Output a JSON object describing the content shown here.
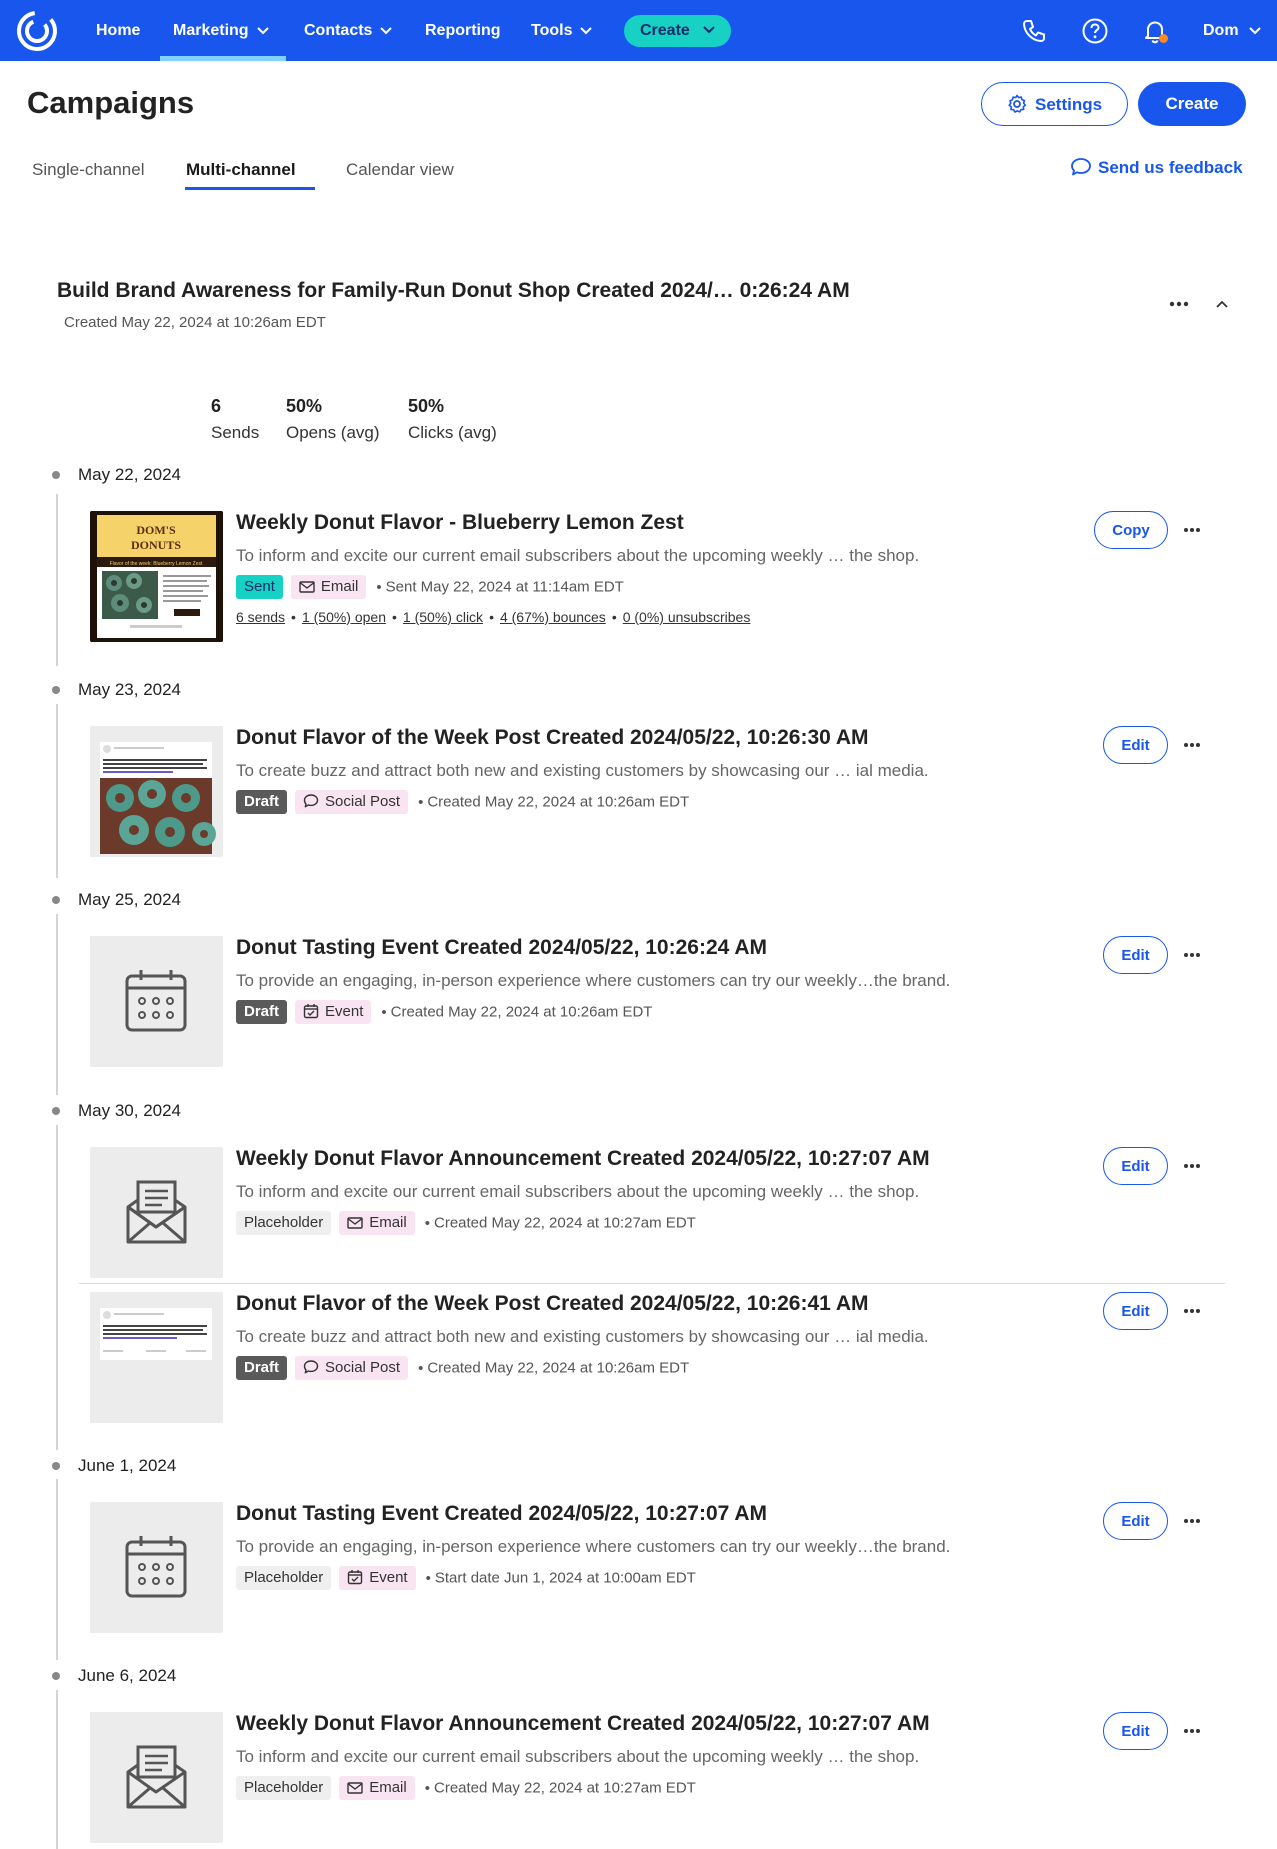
{
  "nav": {
    "home": "Home",
    "marketing": "Marketing",
    "contacts": "Contacts",
    "reporting": "Reporting",
    "tools": "Tools",
    "create": "Create",
    "user": "Dom"
  },
  "header": {
    "title": "Campaigns",
    "settings_label": "Settings",
    "create_label": "Create"
  },
  "tabs": {
    "single": "Single-channel",
    "multi": "Multi-channel",
    "calendar": "Calendar view",
    "feedback": "Send us feedback"
  },
  "campaign": {
    "title": "Build Brand Awareness for Family-Run Donut Shop Created 2024/… 0:26:24 AM",
    "created": "Created May 22, 2024 at 10:26am EDT",
    "stats": [
      {
        "num": "6",
        "label": "Sends"
      },
      {
        "num": "50%",
        "label": "Opens (avg)"
      },
      {
        "num": "50%",
        "label": "Clicks (avg)"
      }
    ]
  },
  "dates": [
    "May 22, 2024",
    "May 23, 2024",
    "May 25, 2024",
    "May 30, 2024",
    "June 1, 2024",
    "June 6, 2024"
  ],
  "items": [
    {
      "title": "Weekly Donut Flavor - Blueberry Lemon Zest",
      "desc": "To inform and excite our current email subscribers about the upcoming weekly … the shop.",
      "status": "Sent",
      "type": "Email",
      "meta": "Sent May 22, 2024 at 11:14am EDT",
      "button": "Copy",
      "stats": {
        "sends": "6 sends",
        "open": "1 (50%) open",
        "click": "1 (50%) click",
        "bounces": "4 (67%) bounces",
        "unsubs": "0 (0%) unsubscribes"
      },
      "thumb": {
        "brand": "DOM'S DONUTS",
        "headline": "Flavor of the week: Blueberry Lemon Zest"
      }
    },
    {
      "title": "Donut Flavor of the Week Post Created 2024/05/22, 10:26:30 AM",
      "desc": "To create buzz and attract both new and existing customers by showcasing our … ial media.",
      "status": "Draft",
      "type": "Social Post",
      "meta": "Created May 22, 2024 at 10:26am EDT",
      "button": "Edit"
    },
    {
      "title": "Donut Tasting Event Created 2024/05/22, 10:26:24 AM",
      "desc": "To provide an engaging, in-person experience where customers can try our weekly…the brand.",
      "status": "Draft",
      "type": "Event",
      "meta": "Created May 22, 2024 at 10:26am EDT",
      "button": "Edit"
    },
    {
      "title": "Weekly Donut Flavor Announcement Created 2024/05/22, 10:27:07 AM",
      "desc": "To inform and excite our current email subscribers about the upcoming weekly … the shop.",
      "status": "Placeholder",
      "type": "Email",
      "meta": "Created May 22, 2024 at 10:27am EDT",
      "button": "Edit"
    },
    {
      "title": "Donut Flavor of the Week Post Created 2024/05/22, 10:26:41 AM",
      "desc": "To create buzz and attract both new and existing customers by showcasing our … ial media.",
      "status": "Draft",
      "type": "Social Post",
      "meta": "Created May 22, 2024 at 10:26am EDT",
      "button": "Edit"
    },
    {
      "title": "Donut Tasting Event Created 2024/05/22, 10:27:07 AM",
      "desc": "To provide an engaging, in-person experience where customers can try our weekly…the brand.",
      "status": "Placeholder",
      "type": "Event",
      "meta": "Start date Jun 1, 2024 at 10:00am EDT",
      "button": "Edit"
    },
    {
      "title": "Weekly Donut Flavor Announcement Created 2024/05/22, 10:27:07 AM",
      "desc": "To inform and excite our current email subscribers about the upcoming weekly … the shop.",
      "status": "Placeholder",
      "type": "Email",
      "meta": "Created May 22, 2024 at 10:27am EDT",
      "button": "Edit"
    }
  ],
  "colors": {
    "brand_blue": "#1856ed",
    "teal": "#17d1c4",
    "notif": "#ff8a1f"
  },
  "icons": [
    "logo-icon",
    "chevron-down-icon",
    "phone-icon",
    "help-icon",
    "bell-icon",
    "gear-icon",
    "chat-bubble-icon",
    "more-icon",
    "chevron-up-icon",
    "email-icon",
    "calendar-icon"
  ]
}
